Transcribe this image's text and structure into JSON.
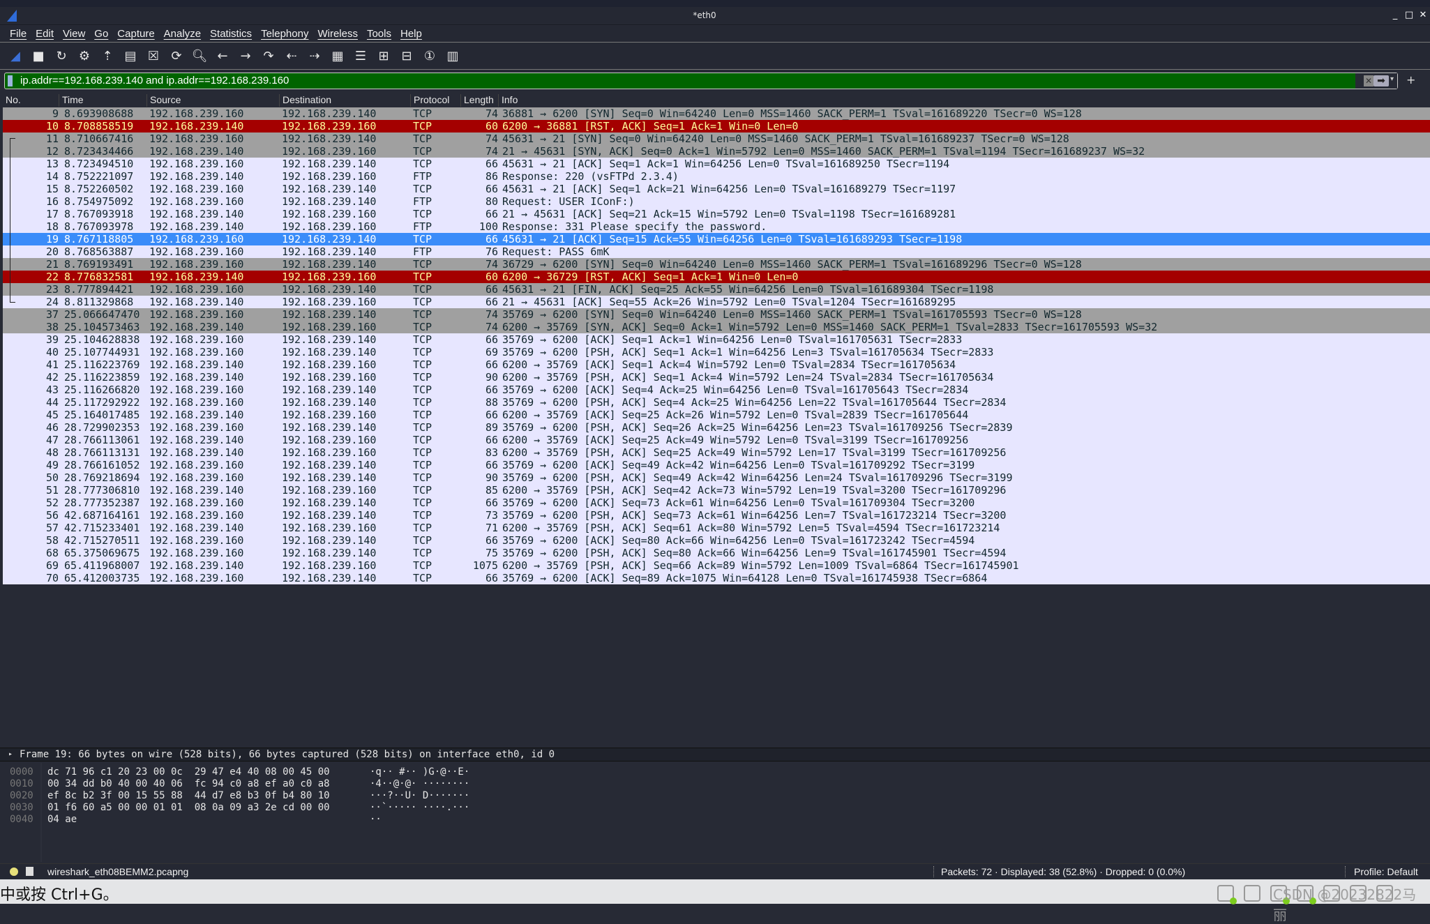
{
  "window": {
    "title": "*eth0",
    "minimize": "_",
    "maximize": "□",
    "close": "✕"
  },
  "menu": [
    "File",
    "Edit",
    "View",
    "Go",
    "Capture",
    "Analyze",
    "Statistics",
    "Telephony",
    "Wireless",
    "Tools",
    "Help"
  ],
  "toolbar": [
    {
      "icon": "shark-fin-start-icon",
      "glyph": "◢"
    },
    {
      "icon": "stop-capture-icon",
      "glyph": "■"
    },
    {
      "icon": "restart-capture-icon",
      "glyph": "↻"
    },
    {
      "icon": "capture-options-gear-icon",
      "glyph": "⚙"
    },
    {
      "icon": "open-file-icon",
      "glyph": "⇡"
    },
    {
      "icon": "save-file-icon",
      "glyph": "▤"
    },
    {
      "icon": "close-file-icon",
      "glyph": "☒"
    },
    {
      "icon": "reload-file-icon",
      "glyph": "⟳"
    },
    {
      "icon": "find-packet-icon",
      "glyph": "🔍︎"
    },
    {
      "icon": "go-back-icon",
      "glyph": "←"
    },
    {
      "icon": "go-forward-icon",
      "glyph": "→"
    },
    {
      "icon": "go-to-packet-icon",
      "glyph": "↷"
    },
    {
      "icon": "first-packet-icon",
      "glyph": "⇠"
    },
    {
      "icon": "last-packet-icon",
      "glyph": "⇢"
    },
    {
      "icon": "auto-scroll-icon",
      "glyph": "▦"
    },
    {
      "icon": "colorize-icon",
      "glyph": "☰"
    },
    {
      "icon": "zoom-in-icon",
      "glyph": "⊞"
    },
    {
      "icon": "zoom-out-icon",
      "glyph": "⊟"
    },
    {
      "icon": "normal-size-icon",
      "glyph": "①"
    },
    {
      "icon": "resize-columns-icon",
      "glyph": "▥"
    }
  ],
  "filter": {
    "value": "ip.addr==192.168.239.140 and ip.addr==192.168.239.160",
    "clear": "✕",
    "apply": "➡",
    "dropdown": "▾",
    "add": "+",
    "color": "#006400"
  },
  "columns": [
    "No.",
    "Time",
    "Source",
    "Destination",
    "Protocol",
    "Length",
    "Info"
  ],
  "colors": {
    "light": "#e7e6ff",
    "gray": "#a0a0a0",
    "red": "#a40000",
    "red_text": "#fffc9c",
    "selected": "#3a8cf9"
  },
  "packets": [
    [
      "9",
      "8.693908688",
      "192.168.239.160",
      "192.168.239.140",
      "TCP",
      "74",
      "36881 → 6200 [SYN] Seq=0 Win=64240 Len=0 MSS=1460 SACK_PERM=1 TSval=161689220 TSecr=0 WS=128",
      "gray"
    ],
    [
      "10",
      "8.708858519",
      "192.168.239.140",
      "192.168.239.160",
      "TCP",
      "60",
      "6200 → 36881 [RST, ACK] Seq=1 Ack=1 Win=0 Len=0",
      "red"
    ],
    [
      "11",
      "8.710667416",
      "192.168.239.160",
      "192.168.239.140",
      "TCP",
      "74",
      "45631 → 21 [SYN] Seq=0 Win=64240 Len=0 MSS=1460 SACK_PERM=1 TSval=161689237 TSecr=0 WS=128",
      "gray"
    ],
    [
      "12",
      "8.723434466",
      "192.168.239.140",
      "192.168.239.160",
      "TCP",
      "74",
      "21 → 45631 [SYN, ACK] Seq=0 Ack=1 Win=5792 Len=0 MSS=1460 SACK_PERM=1 TSval=1194 TSecr=161689237 WS=32",
      "gray"
    ],
    [
      "13",
      "8.723494510",
      "192.168.239.160",
      "192.168.239.140",
      "TCP",
      "66",
      "45631 → 21 [ACK] Seq=1 Ack=1 Win=64256 Len=0 TSval=161689250 TSecr=1194",
      "light"
    ],
    [
      "14",
      "8.752221097",
      "192.168.239.140",
      "192.168.239.160",
      "FTP",
      "86",
      "Response: 220 (vsFTPd 2.3.4)",
      "light"
    ],
    [
      "15",
      "8.752260502",
      "192.168.239.160",
      "192.168.239.140",
      "TCP",
      "66",
      "45631 → 21 [ACK] Seq=1 Ack=21 Win=64256 Len=0 TSval=161689279 TSecr=1197",
      "light"
    ],
    [
      "16",
      "8.754975092",
      "192.168.239.160",
      "192.168.239.140",
      "FTP",
      "80",
      "Request: USER IConF:)",
      "light"
    ],
    [
      "17",
      "8.767093918",
      "192.168.239.140",
      "192.168.239.160",
      "TCP",
      "66",
      "21 → 45631 [ACK] Seq=21 Ack=15 Win=5792 Len=0 TSval=1198 TSecr=161689281",
      "light"
    ],
    [
      "18",
      "8.767093978",
      "192.168.239.140",
      "192.168.239.160",
      "FTP",
      "100",
      "Response: 331 Please specify the password.",
      "light"
    ],
    [
      "19",
      "8.767118805",
      "192.168.239.160",
      "192.168.239.140",
      "TCP",
      "66",
      "45631 → 21 [ACK] Seq=15 Ack=55 Win=64256 Len=0 TSval=161689293 TSecr=1198",
      "sel"
    ],
    [
      "20",
      "8.768563887",
      "192.168.239.160",
      "192.168.239.140",
      "FTP",
      "76",
      "Request: PASS 6mK",
      "light"
    ],
    [
      "21",
      "8.769193491",
      "192.168.239.160",
      "192.168.239.140",
      "TCP",
      "74",
      "36729 → 6200 [SYN] Seq=0 Win=64240 Len=0 MSS=1460 SACK_PERM=1 TSval=161689296 TSecr=0 WS=128",
      "gray"
    ],
    [
      "22",
      "8.776832581",
      "192.168.239.140",
      "192.168.239.160",
      "TCP",
      "60",
      "6200 → 36729 [RST, ACK] Seq=1 Ack=1 Win=0 Len=0",
      "red"
    ],
    [
      "23",
      "8.777894421",
      "192.168.239.160",
      "192.168.239.140",
      "TCP",
      "66",
      "45631 → 21 [FIN, ACK] Seq=25 Ack=55 Win=64256 Len=0 TSval=161689304 TSecr=1198",
      "gray"
    ],
    [
      "24",
      "8.811329868",
      "192.168.239.140",
      "192.168.239.160",
      "TCP",
      "66",
      "21 → 45631 [ACK] Seq=55 Ack=26 Win=5792 Len=0 TSval=1204 TSecr=161689295",
      "light"
    ],
    [
      "37",
      "25.066647470",
      "192.168.239.160",
      "192.168.239.140",
      "TCP",
      "74",
      "35769 → 6200 [SYN] Seq=0 Win=64240 Len=0 MSS=1460 SACK_PERM=1 TSval=161705593 TSecr=0 WS=128",
      "gray"
    ],
    [
      "38",
      "25.104573463",
      "192.168.239.140",
      "192.168.239.160",
      "TCP",
      "74",
      "6200 → 35769 [SYN, ACK] Seq=0 Ack=1 Win=5792 Len=0 MSS=1460 SACK_PERM=1 TSval=2833 TSecr=161705593 WS=32",
      "gray"
    ],
    [
      "39",
      "25.104628838",
      "192.168.239.160",
      "192.168.239.140",
      "TCP",
      "66",
      "35769 → 6200 [ACK] Seq=1 Ack=1 Win=64256 Len=0 TSval=161705631 TSecr=2833",
      "light"
    ],
    [
      "40",
      "25.107744931",
      "192.168.239.160",
      "192.168.239.140",
      "TCP",
      "69",
      "35769 → 6200 [PSH, ACK] Seq=1 Ack=1 Win=64256 Len=3 TSval=161705634 TSecr=2833",
      "light"
    ],
    [
      "41",
      "25.116223769",
      "192.168.239.140",
      "192.168.239.160",
      "TCP",
      "66",
      "6200 → 35769 [ACK] Seq=1 Ack=4 Win=5792 Len=0 TSval=2834 TSecr=161705634",
      "light"
    ],
    [
      "42",
      "25.116223859",
      "192.168.239.140",
      "192.168.239.160",
      "TCP",
      "90",
      "6200 → 35769 [PSH, ACK] Seq=1 Ack=4 Win=5792 Len=24 TSval=2834 TSecr=161705634",
      "light"
    ],
    [
      "43",
      "25.116266820",
      "192.168.239.160",
      "192.168.239.140",
      "TCP",
      "66",
      "35769 → 6200 [ACK] Seq=4 Ack=25 Win=64256 Len=0 TSval=161705643 TSecr=2834",
      "light"
    ],
    [
      "44",
      "25.117292922",
      "192.168.239.160",
      "192.168.239.140",
      "TCP",
      "88",
      "35769 → 6200 [PSH, ACK] Seq=4 Ack=25 Win=64256 Len=22 TSval=161705644 TSecr=2834",
      "light"
    ],
    [
      "45",
      "25.164017485",
      "192.168.239.140",
      "192.168.239.160",
      "TCP",
      "66",
      "6200 → 35769 [ACK] Seq=25 Ack=26 Win=5792 Len=0 TSval=2839 TSecr=161705644",
      "light"
    ],
    [
      "46",
      "28.729902353",
      "192.168.239.160",
      "192.168.239.140",
      "TCP",
      "89",
      "35769 → 6200 [PSH, ACK] Seq=26 Ack=25 Win=64256 Len=23 TSval=161709256 TSecr=2839",
      "light"
    ],
    [
      "47",
      "28.766113061",
      "192.168.239.140",
      "192.168.239.160",
      "TCP",
      "66",
      "6200 → 35769 [ACK] Seq=25 Ack=49 Win=5792 Len=0 TSval=3199 TSecr=161709256",
      "light"
    ],
    [
      "48",
      "28.766113131",
      "192.168.239.140",
      "192.168.239.160",
      "TCP",
      "83",
      "6200 → 35769 [PSH, ACK] Seq=25 Ack=49 Win=5792 Len=17 TSval=3199 TSecr=161709256",
      "light"
    ],
    [
      "49",
      "28.766161052",
      "192.168.239.160",
      "192.168.239.140",
      "TCP",
      "66",
      "35769 → 6200 [ACK] Seq=49 Ack=42 Win=64256 Len=0 TSval=161709292 TSecr=3199",
      "light"
    ],
    [
      "50",
      "28.769218694",
      "192.168.239.160",
      "192.168.239.140",
      "TCP",
      "90",
      "35769 → 6200 [PSH, ACK] Seq=49 Ack=42 Win=64256 Len=24 TSval=161709296 TSecr=3199",
      "light"
    ],
    [
      "51",
      "28.777306810",
      "192.168.239.140",
      "192.168.239.160",
      "TCP",
      "85",
      "6200 → 35769 [PSH, ACK] Seq=42 Ack=73 Win=5792 Len=19 TSval=3200 TSecr=161709296",
      "light"
    ],
    [
      "52",
      "28.777352387",
      "192.168.239.160",
      "192.168.239.140",
      "TCP",
      "66",
      "35769 → 6200 [ACK] Seq=73 Ack=61 Win=64256 Len=0 TSval=161709304 TSecr=3200",
      "light"
    ],
    [
      "56",
      "42.687164161",
      "192.168.239.160",
      "192.168.239.140",
      "TCP",
      "73",
      "35769 → 6200 [PSH, ACK] Seq=73 Ack=61 Win=64256 Len=7 TSval=161723214 TSecr=3200",
      "light"
    ],
    [
      "57",
      "42.715233401",
      "192.168.239.140",
      "192.168.239.160",
      "TCP",
      "71",
      "6200 → 35769 [PSH, ACK] Seq=61 Ack=80 Win=5792 Len=5 TSval=4594 TSecr=161723214",
      "light"
    ],
    [
      "58",
      "42.715270511",
      "192.168.239.160",
      "192.168.239.140",
      "TCP",
      "66",
      "35769 → 6200 [ACK] Seq=80 Ack=66 Win=64256 Len=0 TSval=161723242 TSecr=4594",
      "light"
    ],
    [
      "68",
      "65.375069675",
      "192.168.239.160",
      "192.168.239.140",
      "TCP",
      "75",
      "35769 → 6200 [PSH, ACK] Seq=80 Ack=66 Win=64256 Len=9 TSval=161745901 TSecr=4594",
      "light"
    ],
    [
      "69",
      "65.411968007",
      "192.168.239.140",
      "192.168.239.160",
      "TCP",
      "1075",
      "6200 → 35769 [PSH, ACK] Seq=66 Ack=89 Win=5792 Len=1009 TSval=6864 TSecr=161745901",
      "light"
    ],
    [
      "70",
      "65.412003735",
      "192.168.239.160",
      "192.168.239.140",
      "TCP",
      "66",
      "35769 → 6200 [ACK] Seq=89 Ack=1075 Win=64128 Len=0 TSval=161745938 TSecr=6864",
      "light"
    ]
  ],
  "detail": {
    "text": "Frame 19: 66 bytes on wire (528 bits), 66 bytes captured (528 bits) on interface eth0, id 0",
    "arrow": "▸"
  },
  "hex": {
    "offsets": [
      "0000",
      "0010",
      "0020",
      "0030",
      "0040"
    ],
    "bytes": [
      "dc 71 96 c1 20 23 00 0c  29 47 e4 40 08 00 45 00",
      "00 34 dd b0 40 00 40 06  fc 94 c0 a8 ef a0 c0 a8",
      "ef 8c b2 3f 00 15 55 88  44 d7 e8 b3 0f b4 80 10",
      "01 f6 60 a5 00 00 01 01  08 0a 09 a3 2e cd 00 00",
      "04 ae"
    ],
    "ascii": [
      "·q·· #·· )G·@··E·",
      "·4··@·@· ········",
      "···?··U· D·······",
      "··`····· ····.···",
      "··"
    ]
  },
  "status": {
    "file": "wireshark_eth08BEMM2.pcapng",
    "packets": "Packets: 72 · Displayed: 38 (52.8%) · Dropped: 0 (0.0%)",
    "profile": "Profile: Default"
  },
  "bottom": {
    "hint": "中或按 Ctrl+G。",
    "watermark": "CSDN @20232822马丽"
  }
}
